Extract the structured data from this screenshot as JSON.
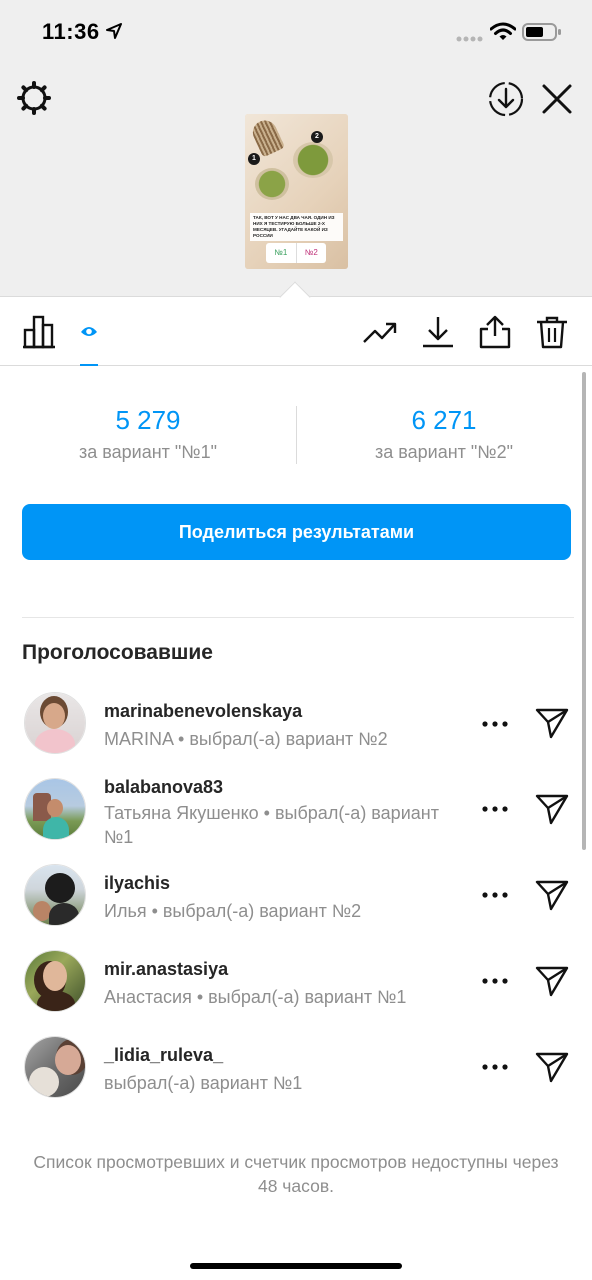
{
  "status_bar": {
    "time": "11:36"
  },
  "story_preview": {
    "badge_1": "1",
    "badge_2": "2",
    "caption": "Так, вот у нас два чая. Один из них я тестирую больше 2-х месяцев. Угадайте какой из России",
    "poll_option_1": "№1",
    "poll_option_2": "№2"
  },
  "stats": {
    "option1_count": "5 279",
    "option1_label": "за вариант \"№1\"",
    "option2_count": "6 271",
    "option2_label": "за вариант \"№2\""
  },
  "share_button_label": "Поделиться результатами",
  "voters_section": {
    "title": "Проголосовавшие",
    "voters": [
      {
        "username": "marinabenevolenskaya",
        "subtitle": "MARINA • выбрал(-а) вариант №2"
      },
      {
        "username": "balabanova83",
        "subtitle": "Татьяна Якушенко • выбрал(-а) вариант №1"
      },
      {
        "username": "ilyachis",
        "subtitle": "Илья • выбрал(-а) вариант №2"
      },
      {
        "username": "mir.anastasiya",
        "subtitle": "Анастасия • выбрал(-а) вариант №1"
      },
      {
        "username": "_lidia_ruleva_",
        "subtitle": "выбрал(-а) вариант №1"
      }
    ]
  },
  "footer_note": "Список просмотревших и счетчик просмотров недоступны через 48 часов.",
  "icons": {
    "settings": "gear-icon",
    "download": "download-circle-icon",
    "close": "close-icon",
    "results_tab": "bar-chart-icon",
    "viewers_tab": "eye-icon",
    "insights": "trending-up-icon",
    "save": "download-icon",
    "share": "share-icon",
    "delete": "trash-icon",
    "more": "more-horizontal-icon",
    "send": "paper-plane-icon"
  },
  "colors": {
    "accent": "#0095f6",
    "secondary_text": "#8e8e8e",
    "primary_text": "#262626",
    "top_background": "#efefef"
  }
}
